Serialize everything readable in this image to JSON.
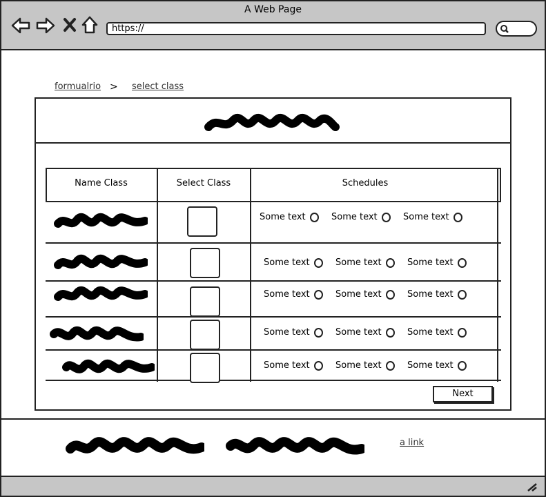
{
  "window": {
    "title": "A Web Page"
  },
  "address_bar": {
    "url": "https://"
  },
  "breadcrumb": {
    "items": [
      "formualrio",
      "select class"
    ],
    "separator": ">"
  },
  "table": {
    "headers": [
      "Name Class",
      "Select Class",
      "Schedules"
    ],
    "option_label": "Some text",
    "rows": [
      {
        "options": [
          "Some text",
          "Some text",
          "Some text"
        ]
      },
      {
        "options": [
          "Some text",
          "Some text",
          "Some text"
        ]
      },
      {
        "options": [
          "Some text",
          "Some text",
          "Some text"
        ]
      },
      {
        "options": [
          "Some text",
          "Some text",
          "Some text"
        ]
      },
      {
        "options": [
          "Some text",
          "Some text",
          "Some text"
        ]
      }
    ]
  },
  "actions": {
    "next_label": "Next"
  },
  "footer": {
    "link_label": "a link"
  }
}
